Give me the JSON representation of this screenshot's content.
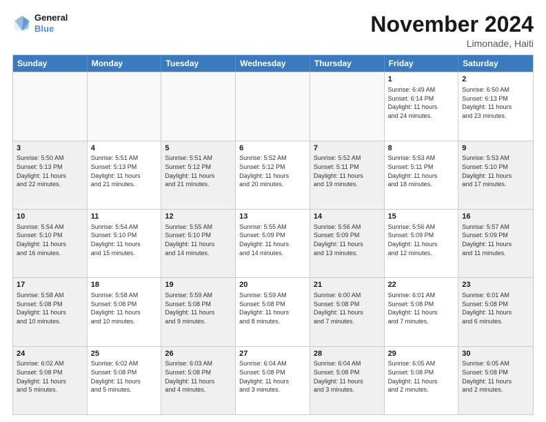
{
  "header": {
    "logo_line1": "General",
    "logo_line2": "Blue",
    "month": "November 2024",
    "location": "Limonade, Haiti"
  },
  "weekdays": [
    "Sunday",
    "Monday",
    "Tuesday",
    "Wednesday",
    "Thursday",
    "Friday",
    "Saturday"
  ],
  "rows": [
    [
      {
        "day": "",
        "info": "",
        "shaded": true
      },
      {
        "day": "",
        "info": "",
        "shaded": true
      },
      {
        "day": "",
        "info": "",
        "shaded": true
      },
      {
        "day": "",
        "info": "",
        "shaded": true
      },
      {
        "day": "",
        "info": "",
        "shaded": true
      },
      {
        "day": "1",
        "info": "Sunrise: 6:49 AM\nSunset: 6:14 PM\nDaylight: 11 hours\nand 24 minutes.",
        "shaded": false
      },
      {
        "day": "2",
        "info": "Sunrise: 6:50 AM\nSunset: 6:13 PM\nDaylight: 11 hours\nand 23 minutes.",
        "shaded": false
      }
    ],
    [
      {
        "day": "3",
        "info": "Sunrise: 5:50 AM\nSunset: 5:13 PM\nDaylight: 11 hours\nand 22 minutes.",
        "shaded": true
      },
      {
        "day": "4",
        "info": "Sunrise: 5:51 AM\nSunset: 5:13 PM\nDaylight: 11 hours\nand 21 minutes.",
        "shaded": false
      },
      {
        "day": "5",
        "info": "Sunrise: 5:51 AM\nSunset: 5:12 PM\nDaylight: 11 hours\nand 21 minutes.",
        "shaded": true
      },
      {
        "day": "6",
        "info": "Sunrise: 5:52 AM\nSunset: 5:12 PM\nDaylight: 11 hours\nand 20 minutes.",
        "shaded": false
      },
      {
        "day": "7",
        "info": "Sunrise: 5:52 AM\nSunset: 5:11 PM\nDaylight: 11 hours\nand 19 minutes.",
        "shaded": true
      },
      {
        "day": "8",
        "info": "Sunrise: 5:53 AM\nSunset: 5:11 PM\nDaylight: 11 hours\nand 18 minutes.",
        "shaded": false
      },
      {
        "day": "9",
        "info": "Sunrise: 5:53 AM\nSunset: 5:10 PM\nDaylight: 11 hours\nand 17 minutes.",
        "shaded": true
      }
    ],
    [
      {
        "day": "10",
        "info": "Sunrise: 5:54 AM\nSunset: 5:10 PM\nDaylight: 11 hours\nand 16 minutes.",
        "shaded": true
      },
      {
        "day": "11",
        "info": "Sunrise: 5:54 AM\nSunset: 5:10 PM\nDaylight: 11 hours\nand 15 minutes.",
        "shaded": false
      },
      {
        "day": "12",
        "info": "Sunrise: 5:55 AM\nSunset: 5:10 PM\nDaylight: 11 hours\nand 14 minutes.",
        "shaded": true
      },
      {
        "day": "13",
        "info": "Sunrise: 5:55 AM\nSunset: 5:09 PM\nDaylight: 11 hours\nand 14 minutes.",
        "shaded": false
      },
      {
        "day": "14",
        "info": "Sunrise: 5:56 AM\nSunset: 5:09 PM\nDaylight: 11 hours\nand 13 minutes.",
        "shaded": true
      },
      {
        "day": "15",
        "info": "Sunrise: 5:56 AM\nSunset: 5:09 PM\nDaylight: 11 hours\nand 12 minutes.",
        "shaded": false
      },
      {
        "day": "16",
        "info": "Sunrise: 5:57 AM\nSunset: 5:09 PM\nDaylight: 11 hours\nand 11 minutes.",
        "shaded": true
      }
    ],
    [
      {
        "day": "17",
        "info": "Sunrise: 5:58 AM\nSunset: 5:08 PM\nDaylight: 11 hours\nand 10 minutes.",
        "shaded": true
      },
      {
        "day": "18",
        "info": "Sunrise: 5:58 AM\nSunset: 5:08 PM\nDaylight: 11 hours\nand 10 minutes.",
        "shaded": false
      },
      {
        "day": "19",
        "info": "Sunrise: 5:59 AM\nSunset: 5:08 PM\nDaylight: 11 hours\nand 9 minutes.",
        "shaded": true
      },
      {
        "day": "20",
        "info": "Sunrise: 5:59 AM\nSunset: 5:08 PM\nDaylight: 11 hours\nand 8 minutes.",
        "shaded": false
      },
      {
        "day": "21",
        "info": "Sunrise: 6:00 AM\nSunset: 5:08 PM\nDaylight: 11 hours\nand 7 minutes.",
        "shaded": true
      },
      {
        "day": "22",
        "info": "Sunrise: 6:01 AM\nSunset: 5:08 PM\nDaylight: 11 hours\nand 7 minutes.",
        "shaded": false
      },
      {
        "day": "23",
        "info": "Sunrise: 6:01 AM\nSunset: 5:08 PM\nDaylight: 11 hours\nand 6 minutes.",
        "shaded": true
      }
    ],
    [
      {
        "day": "24",
        "info": "Sunrise: 6:02 AM\nSunset: 5:08 PM\nDaylight: 11 hours\nand 5 minutes.",
        "shaded": true
      },
      {
        "day": "25",
        "info": "Sunrise: 6:02 AM\nSunset: 5:08 PM\nDaylight: 11 hours\nand 5 minutes.",
        "shaded": false
      },
      {
        "day": "26",
        "info": "Sunrise: 6:03 AM\nSunset: 5:08 PM\nDaylight: 11 hours\nand 4 minutes.",
        "shaded": true
      },
      {
        "day": "27",
        "info": "Sunrise: 6:04 AM\nSunset: 5:08 PM\nDaylight: 11 hours\nand 3 minutes.",
        "shaded": false
      },
      {
        "day": "28",
        "info": "Sunrise: 6:04 AM\nSunset: 5:08 PM\nDaylight: 11 hours\nand 3 minutes.",
        "shaded": true
      },
      {
        "day": "29",
        "info": "Sunrise: 6:05 AM\nSunset: 5:08 PM\nDaylight: 11 hours\nand 2 minutes.",
        "shaded": false
      },
      {
        "day": "30",
        "info": "Sunrise: 6:05 AM\nSunset: 5:08 PM\nDaylight: 11 hours\nand 2 minutes.",
        "shaded": true
      }
    ]
  ]
}
